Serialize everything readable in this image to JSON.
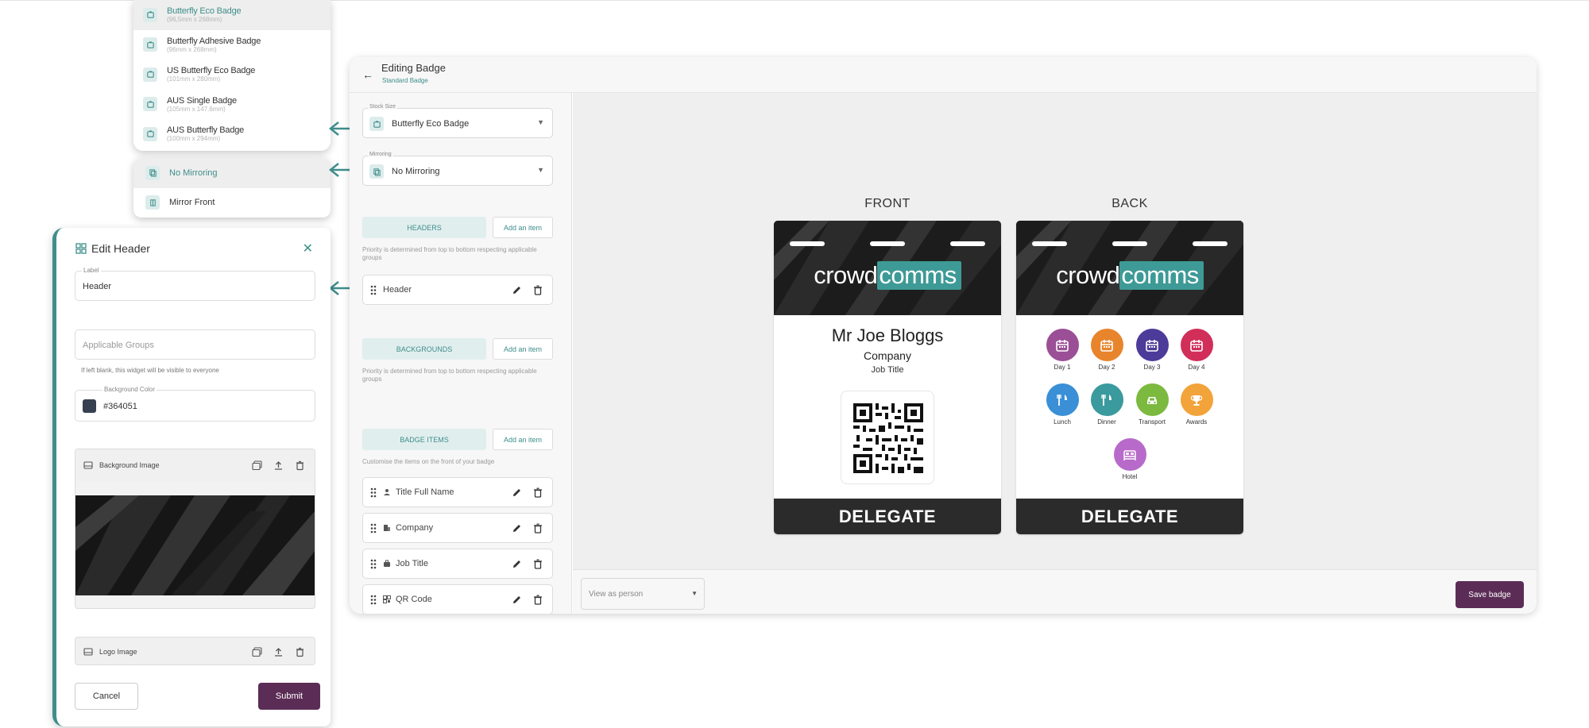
{
  "stock_dropdown": {
    "items": [
      {
        "name": "Butterfly Eco Badge",
        "dim": "(96,5mm x 268mm)",
        "selected": true
      },
      {
        "name": "Butterfly Adhesive Badge",
        "dim": "(96mm x 268mm)",
        "selected": false
      },
      {
        "name": "US Butterfly Eco Badge",
        "dim": "(101mm x 280mm)",
        "selected": false
      },
      {
        "name": "AUS Single Badge",
        "dim": "(105mm x 147.6mm)",
        "selected": false
      },
      {
        "name": "AUS Butterfly Badge",
        "dim": "(100mm x 294mm)",
        "selected": false
      }
    ]
  },
  "mirror_dropdown": {
    "items": [
      {
        "name": "No Mirroring",
        "selected": true
      },
      {
        "name": "Mirror Front",
        "selected": false
      }
    ]
  },
  "edit_header": {
    "title": "Edit Header",
    "label_field": {
      "label": "Label",
      "value": "Header"
    },
    "groups_field": {
      "placeholder": "Applicable Groups",
      "hint": "If left blank, this widget will be visible to everyone"
    },
    "bg_color_field": {
      "label": "Background Color",
      "value": "#364051"
    },
    "background_image_label": "Background Image",
    "logo_image_label": "Logo Image",
    "cancel": "Cancel",
    "submit": "Submit"
  },
  "main": {
    "title": "Editing Badge",
    "subtitle": "Standard Badge",
    "stock_size": {
      "label": "Stock Size",
      "value": "Butterfly Eco Badge"
    },
    "mirroring": {
      "label": "Mirroring",
      "value": "No Mirroring"
    },
    "headers": {
      "tab": "HEADERS",
      "add": "Add an item",
      "note": "Priority is determined from top to bottom respecting applicable groups",
      "items": [
        "Header"
      ]
    },
    "backgrounds": {
      "tab": "BACKGROUNDS",
      "add": "Add an item",
      "note": "Priority is determined from top to bottom respecting applicable groups"
    },
    "badge_items": {
      "tab": "BADGE ITEMS",
      "add": "Add an item",
      "note": "Customise the items on the front of your badge",
      "items": [
        "Title Full Name",
        "Company",
        "Job Title",
        "QR Code"
      ]
    },
    "view_as": "View as person",
    "save": "Save badge"
  },
  "badge": {
    "front_label": "FRONT",
    "back_label": "BACK",
    "logo_left": "crowd",
    "logo_right": "comms",
    "name": "Mr Joe Bloggs",
    "company": "Company",
    "job_title": "Job Title",
    "footer": "DELEGATE",
    "back_icons": [
      {
        "label": "Day 1",
        "color": "#9b4f96"
      },
      {
        "label": "Day 2",
        "color": "#e8852c"
      },
      {
        "label": "Day 3",
        "color": "#4c3b99"
      },
      {
        "label": "Day 4",
        "color": "#d12e5a"
      },
      {
        "label": "Lunch",
        "color": "#3a8fd6"
      },
      {
        "label": "Dinner",
        "color": "#3a9a9e"
      },
      {
        "label": "Transport",
        "color": "#7cb93f"
      },
      {
        "label": "Awards",
        "color": "#f2a33a"
      },
      {
        "label": "Hotel",
        "color": "#b76ac9"
      }
    ]
  },
  "colors": {
    "accent": "#3e8e8b",
    "primary_button": "#5b2d56"
  }
}
